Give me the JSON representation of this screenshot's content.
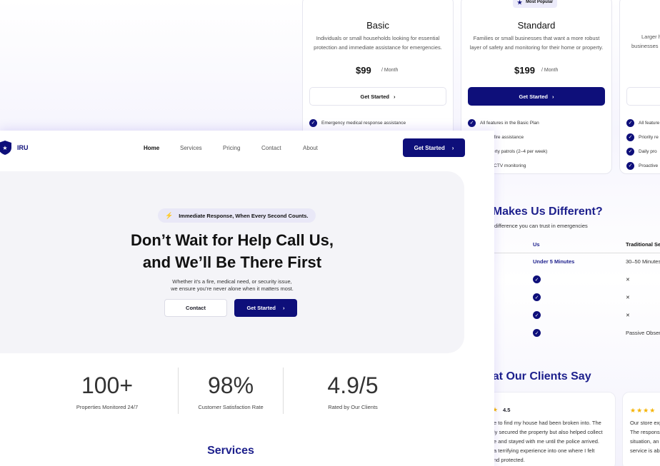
{
  "pricing": {
    "basic": {
      "title": "Basic",
      "desc": "Individuals or small households looking for essential protection and immediate assistance for emergencies.",
      "price": "$99",
      "per": "/ Month",
      "cta": "Get Started",
      "features": [
        "Emergency medical response assistance"
      ]
    },
    "standard": {
      "badge": "Most Popular",
      "title": "Standard",
      "desc": "Families or small businesses that want a more robust layer of safety and monitoring for their home or property.",
      "price": "$199",
      "per": "/ Month",
      "cta": "Get Started",
      "features": [
        "All features in the Basic Plan",
        "anced fire assistance",
        "r property patrols (2–4 per week)",
        "ated CCTV monitoring"
      ]
    },
    "third": {
      "desc1": "Larger h",
      "desc2": "businesses",
      "features": [
        "All feature",
        "Priority re",
        "Daily pro",
        "Proactive"
      ]
    }
  },
  "difference": {
    "title": "t Makes Us Different?",
    "subtitle": "difference you can trust in emergencies",
    "col_us": "Us",
    "col_trad": "Traditional Se",
    "rows": [
      {
        "us": "Under 5 Minutes",
        "trad": "30–50 Minutes"
      },
      {
        "us": "check",
        "trad": "cross"
      },
      {
        "us": "check",
        "trad": "cross"
      },
      {
        "us": "check",
        "trad": "cross"
      },
      {
        "us": "check",
        "trad": "Passive Observ"
      }
    ]
  },
  "clients": {
    "title": "hat Our Clients Say",
    "t1": {
      "stars": "★",
      "rating": "4.5",
      "lines": [
        "e to find my house had been broken into. The",
        "ly secured the property but also helped collect",
        "e and stayed with me until the police arrived.",
        "a terrifying experience into one where I felt",
        "nd protected."
      ]
    },
    "t2": {
      "stars": "★★★★",
      "lines": [
        "Our store exp",
        "The respons",
        "situation, an",
        "service is abs"
      ]
    }
  },
  "nav": {
    "brand": "IRU",
    "items": [
      "Home",
      "Services",
      "Pricing",
      "Contact",
      "About"
    ],
    "cta": "Get Started"
  },
  "hero": {
    "pill": "Immediate Response, When Every Second Counts.",
    "title1": "Don’t Wait for Help Call Us,",
    "title2": "and We’ll Be There First",
    "sub1": "Whether it’s a fire, medical need, or security issue,",
    "sub2": "we ensure you’re never alone when it matters most.",
    "contact": "Contact",
    "start": "Get Started"
  },
  "stats": [
    {
      "value": "100+",
      "label": "Properties Monitored 24/7"
    },
    {
      "value": "98%",
      "label": "Customer Satisfaction Rate"
    },
    {
      "value": "4.9/5",
      "label": "Rated by Our Clients"
    }
  ],
  "services_title": "Services",
  "colors": {
    "brand": "#0e0f7a",
    "heading": "#1c1f8c",
    "hero_bg": "#f4f4f8"
  }
}
